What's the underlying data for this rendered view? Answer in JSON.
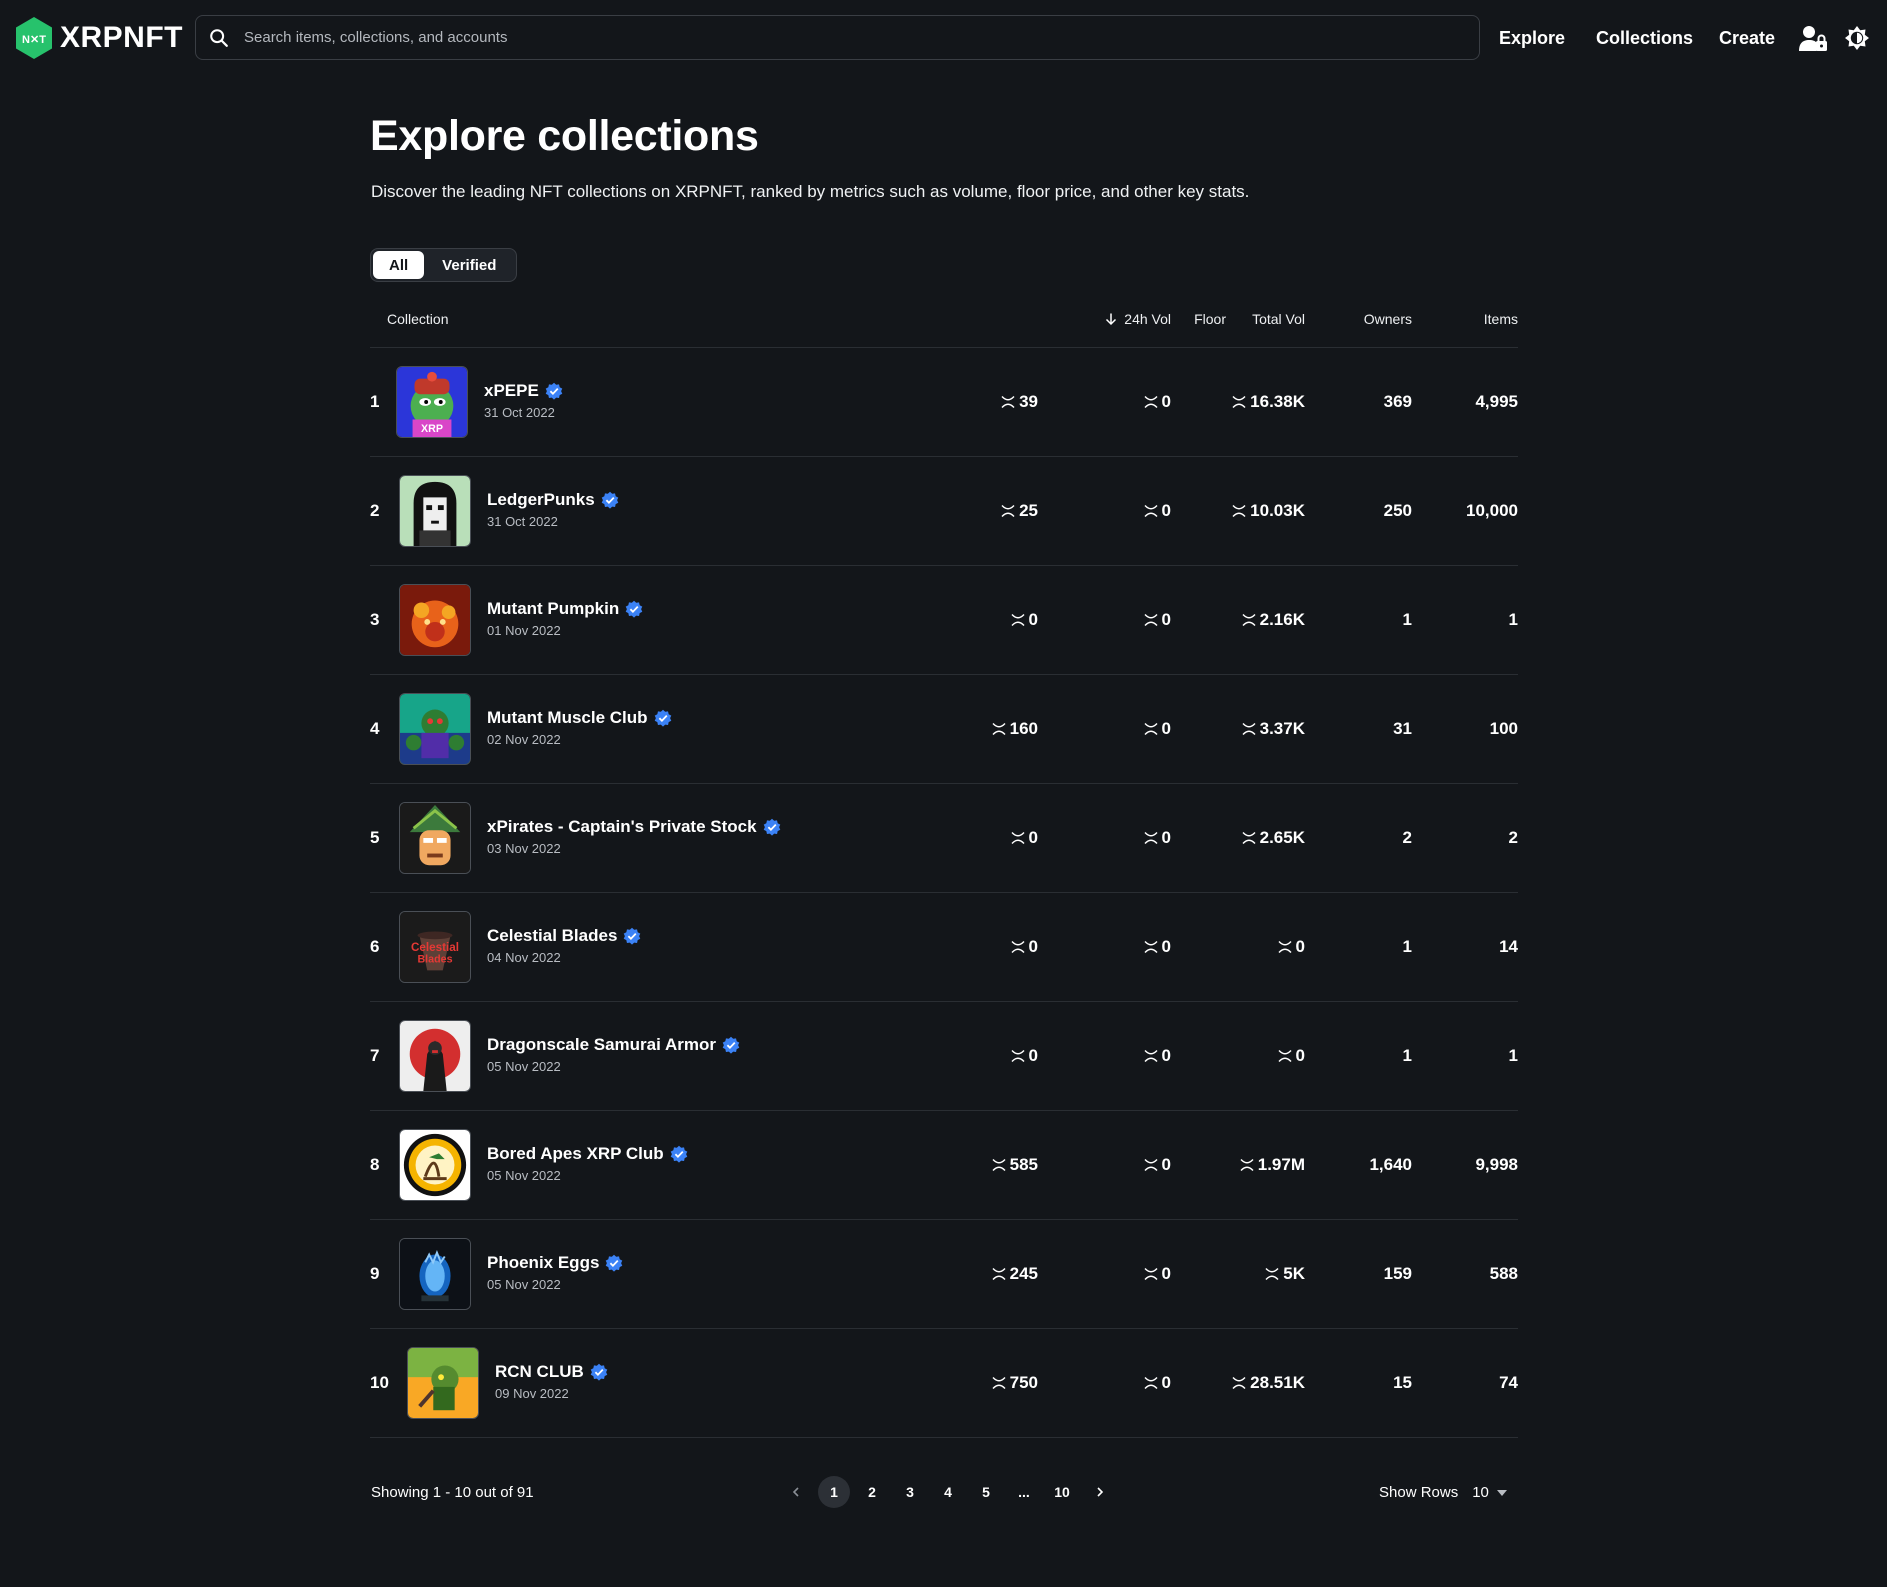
{
  "header": {
    "logo_text": "XRPNFT",
    "search_placeholder": "Search items, collections, and accounts",
    "nav": {
      "explore": "Explore",
      "collections": "Collections",
      "create": "Create"
    }
  },
  "page": {
    "title": "Explore collections",
    "description": "Discover the leading NFT collections on XRPNFT, ranked by metrics such as volume, floor price, and other key stats."
  },
  "filters": {
    "all": "All",
    "verified": "Verified",
    "active": "All"
  },
  "table": {
    "columns": {
      "collection": "Collection",
      "floor": "Floor",
      "vol_24h": "24h Vol",
      "total_vol": "Total Vol",
      "owners": "Owners",
      "items": "Items"
    },
    "sort_column": "24h Vol",
    "rows": [
      {
        "rank": "1",
        "name": "xPEPE",
        "date": "31 Oct 2022",
        "floor": "39",
        "vol_24h": "0",
        "total_vol": "16.38K",
        "owners": "369",
        "items": "4,995",
        "thumb": "pepe",
        "verified": true
      },
      {
        "rank": "2",
        "name": "LedgerPunks",
        "date": "31 Oct 2022",
        "floor": "25",
        "vol_24h": "0",
        "total_vol": "10.03K",
        "owners": "250",
        "items": "10,000",
        "thumb": "punk",
        "verified": true
      },
      {
        "rank": "3",
        "name": "Mutant Pumpkin",
        "date": "01 Nov 2022",
        "floor": "0",
        "vol_24h": "0",
        "total_vol": "2.16K",
        "owners": "1",
        "items": "1",
        "thumb": "pumpkin",
        "verified": true
      },
      {
        "rank": "4",
        "name": "Mutant Muscle Club",
        "date": "02 Nov 2022",
        "floor": "160",
        "vol_24h": "0",
        "total_vol": "3.37K",
        "owners": "31",
        "items": "100",
        "thumb": "muscle",
        "verified": true
      },
      {
        "rank": "5",
        "name": "xPirates - Captain's Private Stock",
        "date": "03 Nov 2022",
        "floor": "0",
        "vol_24h": "0",
        "total_vol": "2.65K",
        "owners": "2",
        "items": "2",
        "thumb": "pirate",
        "verified": true
      },
      {
        "rank": "6",
        "name": "Celestial Blades",
        "date": "04 Nov 2022",
        "floor": "0",
        "vol_24h": "0",
        "total_vol": "0",
        "owners": "1",
        "items": "14",
        "thumb": "blades",
        "verified": true
      },
      {
        "rank": "7",
        "name": "Dragonscale Samurai Armor",
        "date": "05 Nov 2022",
        "floor": "0",
        "vol_24h": "0",
        "total_vol": "0",
        "owners": "1",
        "items": "1",
        "thumb": "samurai",
        "verified": true
      },
      {
        "rank": "8",
        "name": "Bored Apes XRP Club",
        "date": "05 Nov 2022",
        "floor": "585",
        "vol_24h": "0",
        "total_vol": "1.97M",
        "owners": "1,640",
        "items": "9,998",
        "thumb": "bored",
        "verified": true
      },
      {
        "rank": "9",
        "name": "Phoenix Eggs",
        "date": "05 Nov 2022",
        "floor": "245",
        "vol_24h": "0",
        "total_vol": "5K",
        "owners": "159",
        "items": "588",
        "thumb": "egg",
        "verified": true
      },
      {
        "rank": "10",
        "name": "RCN CLUB",
        "date": "09 Nov 2022",
        "floor": "750",
        "vol_24h": "0",
        "total_vol": "28.51K",
        "owners": "15",
        "items": "74",
        "thumb": "rcn",
        "verified": true
      }
    ]
  },
  "footer": {
    "showing": "Showing 1 - 10 out of 91",
    "pages": [
      "1",
      "2",
      "3",
      "4",
      "5",
      "...",
      "10"
    ],
    "current_page": "1",
    "rows_label": "Show Rows",
    "rows_value": "10"
  },
  "colors": {
    "background": "#13161a",
    "logo_green": "#27c26c",
    "verified_blue": "#3b82f6",
    "divider": "#2a2e33"
  }
}
